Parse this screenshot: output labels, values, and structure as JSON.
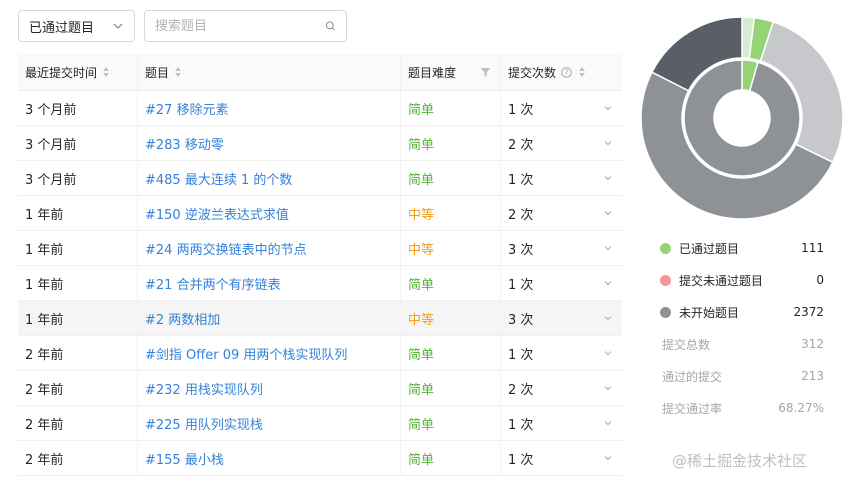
{
  "toolbar": {
    "filter_selected": "已通过题目",
    "search_placeholder": "搜索题目"
  },
  "table": {
    "headers": {
      "time": "最近提交时间",
      "title": "题目",
      "difficulty": "题目难度",
      "submissions": "提交次数"
    },
    "rows": [
      {
        "time": "3 个月前",
        "title": "#27 移除元素",
        "difficulty": "简单",
        "level": "easy",
        "count": "1 次"
      },
      {
        "time": "3 个月前",
        "title": "#283 移动零",
        "difficulty": "简单",
        "level": "easy",
        "count": "2 次"
      },
      {
        "time": "3 个月前",
        "title": "#485 最大连续 1 的个数",
        "difficulty": "简单",
        "level": "easy",
        "count": "1 次"
      },
      {
        "time": "1 年前",
        "title": "#150 逆波兰表达式求值",
        "difficulty": "中等",
        "level": "medium",
        "count": "2 次"
      },
      {
        "time": "1 年前",
        "title": "#24 两两交换链表中的节点",
        "difficulty": "中等",
        "level": "medium",
        "count": "3 次"
      },
      {
        "time": "1 年前",
        "title": "#21 合并两个有序链表",
        "difficulty": "简单",
        "level": "easy",
        "count": "1 次"
      },
      {
        "time": "1 年前",
        "title": "#2 两数相加",
        "difficulty": "中等",
        "level": "medium",
        "count": "3 次"
      },
      {
        "time": "2 年前",
        "title": "#剑指 Offer 09 用两个栈实现队列",
        "difficulty": "简单",
        "level": "easy",
        "count": "1 次"
      },
      {
        "time": "2 年前",
        "title": "#232 用栈实现队列",
        "difficulty": "简单",
        "level": "easy",
        "count": "2 次"
      },
      {
        "time": "2 年前",
        "title": "#225 用队列实现栈",
        "difficulty": "简单",
        "level": "easy",
        "count": "1 次"
      },
      {
        "time": "2 年前",
        "title": "#155 最小栈",
        "difficulty": "简单",
        "level": "easy",
        "count": "1 次"
      }
    ]
  },
  "stats": {
    "passed_label": "已通过题目",
    "passed_value": "111",
    "failed_label": "提交未通过题目",
    "failed_value": "0",
    "unstarted_label": "未开始题目",
    "unstarted_value": "2372",
    "total_submissions_label": "提交总数",
    "total_submissions_value": "312",
    "passed_submissions_label": "通过的提交",
    "passed_submissions_value": "213",
    "pass_rate_label": "提交通过率",
    "pass_rate_value": "68.27%"
  },
  "colors": {
    "passed": "#95d475",
    "failed": "#f4959b",
    "unstarted": "#8e9196",
    "easy": "#53b337",
    "medium": "#f0a01b",
    "link": "#3482d8"
  },
  "watermark": "@稀土掘金技术社区"
}
